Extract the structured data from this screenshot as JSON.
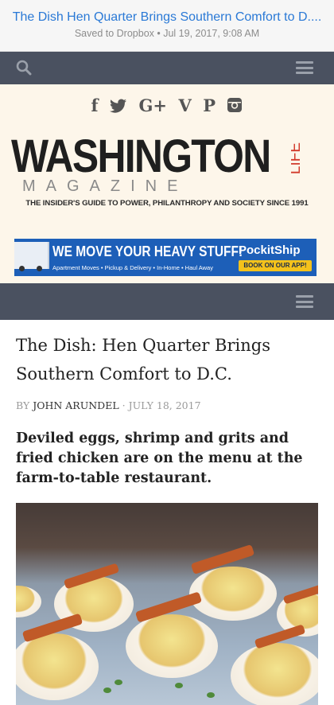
{
  "top_bar": {
    "title": "The Dish Hen Quarter Brings Southern Comfort to D....",
    "subtitle": "Saved to Dropbox • Jul 19, 2017, 9:08 AM"
  },
  "icons": {
    "search": "search-icon",
    "menu": "hamburger-menu-icon"
  },
  "social_icons": [
    "f",
    "t",
    "G+",
    "V",
    "P",
    "◎"
  ],
  "masthead": {
    "logo_main": "WASHINGTON",
    "logo_life": "LIFE",
    "logo_magazine": "MAGAZINE",
    "tagline": "THE INSIDER'S GUIDE TO POWER, PHILANTHROPY AND SOCIETY SINCE 1991"
  },
  "ad": {
    "headline": "WE MOVE YOUR HEAVY STUFF!",
    "services": "Apartment Moves • Pickup & Delivery • In-Home • Haul Away",
    "brand": "PockitShip",
    "cta": "BOOK ON OUR APP!"
  },
  "article": {
    "headline": "The Dish: Hen Quarter Brings Southern Comfort to D.C.",
    "by_prefix": "BY",
    "author": "JOHN ARUNDEL",
    "separator": "·",
    "date": "JULY 18, 2017",
    "dek": "Deviled eggs, shrimp and grits and fried chicken are on the menu at the farm-to-table restaurant."
  },
  "colors": {
    "nav_bg": "#4a5160",
    "masthead_bg": "#fdf6ea",
    "link_blue": "#2a79d6",
    "ad_blue": "#1d5fb8",
    "logo_red": "#d23b2c"
  }
}
